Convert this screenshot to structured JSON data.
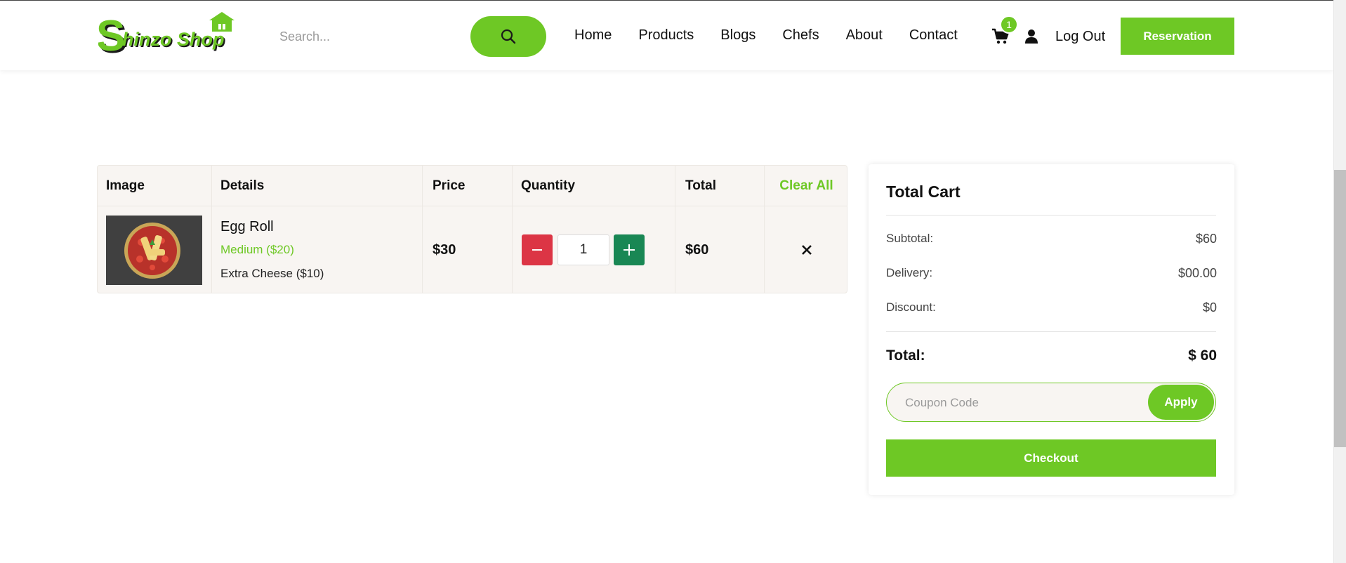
{
  "header": {
    "logo_text": "Shinzo Shop",
    "search_placeholder": "Search...",
    "nav": [
      "Home",
      "Products",
      "Blogs",
      "Chefs",
      "About",
      "Contact"
    ],
    "cart_count": "1",
    "logout_label": "Log Out",
    "reservation_label": "Reservation",
    "brand_color": "#6ec825"
  },
  "table": {
    "headers": {
      "image": "Image",
      "details": "Details",
      "price": "Price",
      "quantity": "Quantity",
      "total": "Total",
      "clear_all": "Clear All"
    },
    "items": [
      {
        "name": "Egg Roll",
        "size": "Medium ($20)",
        "extra": "Extra Cheese ($10)",
        "price": "$30",
        "quantity": "1",
        "total": "$60",
        "remove_icon": "close-icon"
      }
    ]
  },
  "summary": {
    "title": "Total Cart",
    "subtotal_label": "Subtotal:",
    "subtotal_value": "$60",
    "delivery_label": "Delivery:",
    "delivery_value": "$00.00",
    "discount_label": "Discount:",
    "discount_value": "$0",
    "total_label": "Total:",
    "total_value": "$ 60",
    "coupon_placeholder": "Coupon Code",
    "apply_label": "Apply",
    "checkout_label": "Checkout"
  },
  "colors": {
    "accent": "#6ec825",
    "minus_button": "#dc3545",
    "plus_button": "#198754"
  }
}
